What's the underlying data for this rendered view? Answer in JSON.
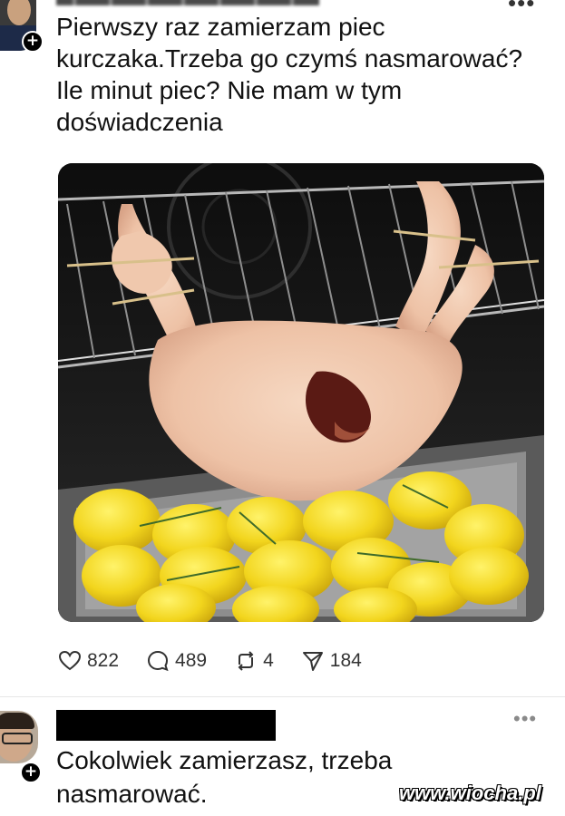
{
  "post": {
    "text": "Pierwszy raz zamierzam piec kurczaka.Trzeba go czymś nasmarować? Ile minut piec? Nie mam w tym doświadczenia",
    "image_icon": "roast-chicken-photo",
    "follow_badge": "+"
  },
  "actions": {
    "likes": "822",
    "comments": "489",
    "reposts": "4",
    "shares": "184"
  },
  "reply": {
    "text": "Cokolwiek zamierzasz, trzeba nasmarować.",
    "follow_badge": "+",
    "more_label": "•••"
  },
  "top_more_label": "•••",
  "watermark": "www.wiocha.pl",
  "colors": {
    "text": "#121212",
    "icon": "#333333",
    "badge": "#000000",
    "redaction": "#000000"
  }
}
